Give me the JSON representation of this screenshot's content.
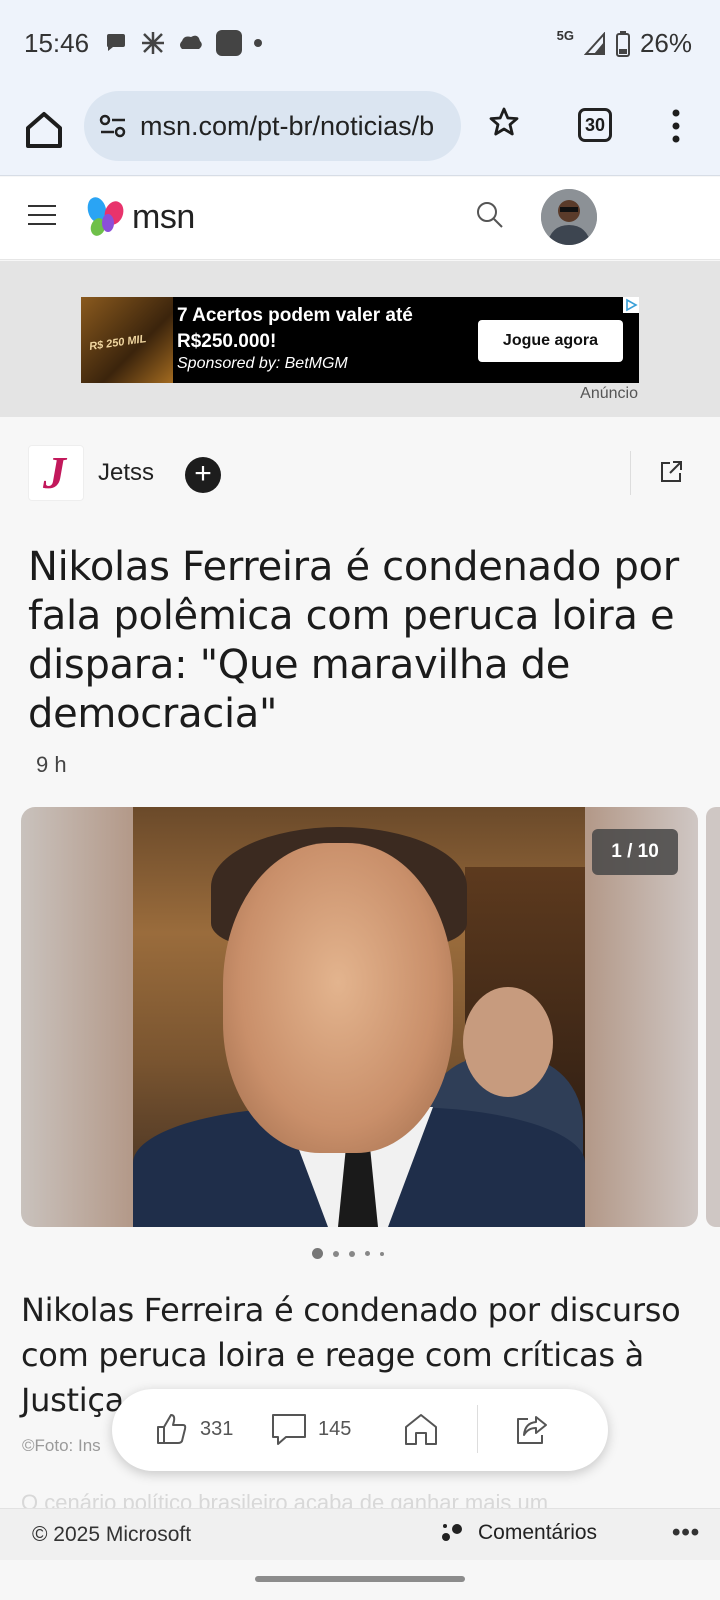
{
  "status_bar": {
    "time": "15:46",
    "network": "5G",
    "battery": "26%",
    "notification_icons": [
      "chat-icon",
      "network-icon",
      "cloud-icon",
      "app-icon",
      "dot-icon"
    ]
  },
  "browser": {
    "url": "msn.com/pt-br/noticias/b",
    "tab_count": "30"
  },
  "msn_header": {
    "brand": "msn"
  },
  "ad": {
    "title": "7 Acertos podem valer até R$250.000!",
    "sponsor": "Sponsored by: BetMGM",
    "cta": "Jogue agora",
    "image_text": "R$ 250 MIL",
    "label": "Anúncio"
  },
  "publisher": {
    "logo_letter": "J",
    "name": "Jetss",
    "follow": "+"
  },
  "article": {
    "headline": "Nikolas Ferreira é condenado por fala polêmica com peruca loira e dispara: \"Que maravilha de democracia\"",
    "age": "9 h",
    "gallery_counter": "1 / 10",
    "subheadline": "Nikolas Ferreira é condenado por discurso com peruca loira e reage com críticas à Justiça",
    "photo_credit": "©Foto: Ins",
    "body_preview": "O cenário político brasileiro acaba de ganhar mais um"
  },
  "actions": {
    "likes": "331",
    "comments": "145"
  },
  "footer": {
    "copyright": "© 2025 Microsoft",
    "comments_label": "Comentários",
    "more": "•••"
  },
  "colors": {
    "status_bg": "#eef3fb",
    "urlbar_bg": "#dbe5f1",
    "ad_bg": "#000000",
    "publisher_accent": "#c2185b"
  }
}
